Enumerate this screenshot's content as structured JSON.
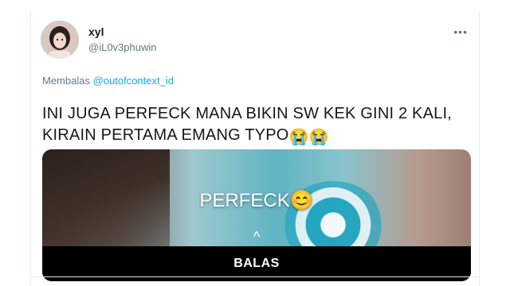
{
  "user": {
    "name": "xyl",
    "handle": "@iL0v3phuwin"
  },
  "reply": {
    "prefix": "Membalas",
    "mention": "@outofcontext_id"
  },
  "tweet": {
    "line1": "INI JUGA PERFECK MANA BIKIN SW KEK GINI 2 KALI,",
    "line2": "KIRAIN PERTAMA EMANG TYPO",
    "emojis": "😭😭"
  },
  "media": {
    "caption": "PERFECK",
    "caption_emoji": "😊",
    "action_label": "BALAS"
  },
  "icons": {
    "more": "more-horizontal-icon",
    "chevron": "chevron-up-icon"
  },
  "colors": {
    "link": "#1da1f2",
    "text": "#14171a",
    "muted": "#657786"
  }
}
